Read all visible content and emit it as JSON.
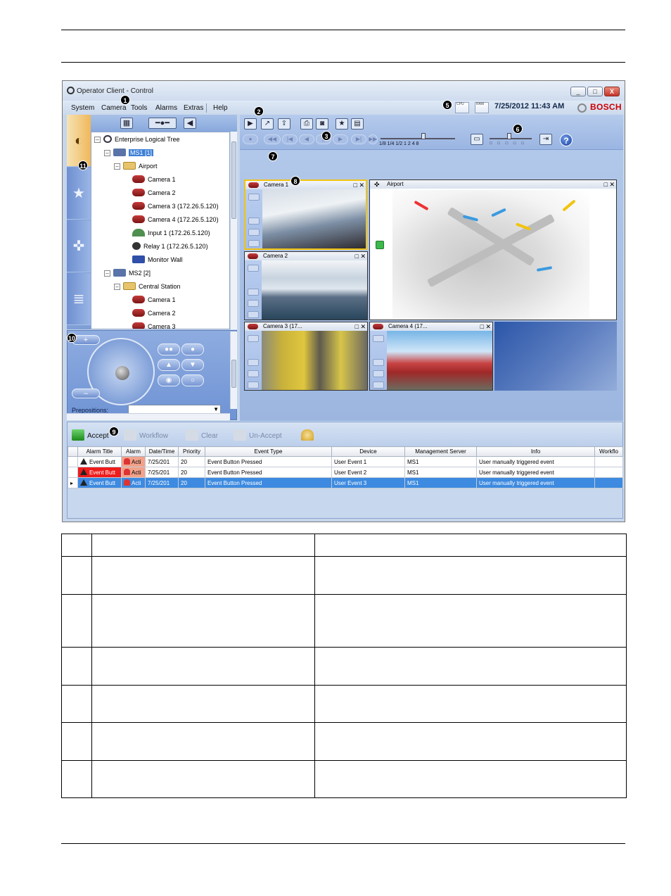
{
  "window": {
    "title": "Operator Client - Control",
    "controls": [
      "_",
      "□",
      "X"
    ]
  },
  "menu": {
    "items": [
      "System",
      "Camera",
      "Tools",
      "Alarms",
      "Extras",
      "Help"
    ],
    "datetime": "7/25/2012 11:43 AM",
    "brand": "BOSCH",
    "meters": [
      "CPU",
      "RAM"
    ]
  },
  "tree": {
    "root": "Enterprise Logical Tree",
    "server1": "MS1 [1]",
    "folder1": "Airport",
    "items1": [
      "Camera 1",
      "Camera 2",
      "Camera 3 (172.26.5.120)",
      "Camera 4 (172.26.5.120)",
      "Input 1 (172.26.5.120)",
      "Relay 1 (172.26.5.120)",
      "Monitor Wall"
    ],
    "server2": "MS2 [2]",
    "folder2": "Central Station",
    "items2": [
      "Camera 1",
      "Camera 2",
      "Camera 3"
    ]
  },
  "ptz": {
    "prepositions_label": "Prepositions:",
    "zoom_in": "+",
    "zoom_out": "–"
  },
  "toolbar": {
    "speed_labels": "1/8 1/4 1/2  1   2   4   8",
    "layout_ticks": "□ □ □ □ □"
  },
  "panes": {
    "camera1": "Camera 1",
    "camera2": "Camera 2",
    "camera3": "Camera 3 (17...",
    "camera4": "Camera 4 (17...",
    "map": "Airport"
  },
  "alarms": {
    "buttons": {
      "accept": "Accept",
      "workflow": "Workflow",
      "clear": "Clear",
      "unaccept": "Un-Accept"
    },
    "columns": [
      "Alarm Title",
      "Alarm",
      "Date/Time",
      "Priority",
      "Event Type",
      "Device",
      "Management Server",
      "Info",
      "Workflo"
    ],
    "rows": [
      [
        "Event Butt",
        "Acti",
        "7/25/201",
        "20",
        "Event Button Pressed",
        "User Event 1",
        "MS1",
        "User manually triggered event",
        ""
      ],
      [
        "Event Butt",
        "Acti",
        "7/25/201",
        "20",
        "Event Button Pressed",
        "User Event 2",
        "MS1",
        "User manually triggered event",
        ""
      ],
      [
        "Event Butt",
        "Acti",
        "7/25/201",
        "20",
        "Event Button Pressed",
        "User Event 3",
        "MS1",
        "User manually triggered event",
        ""
      ]
    ]
  },
  "callouts": [
    "1",
    "2",
    "3",
    "5",
    "6",
    "7",
    "8",
    "9",
    "10",
    "11"
  ],
  "colors": {
    "brand": "#d00000",
    "selected_row": "#3d8ae0",
    "alarm_red": "#ee1c1c",
    "pane_selected": "#f1c40f"
  }
}
